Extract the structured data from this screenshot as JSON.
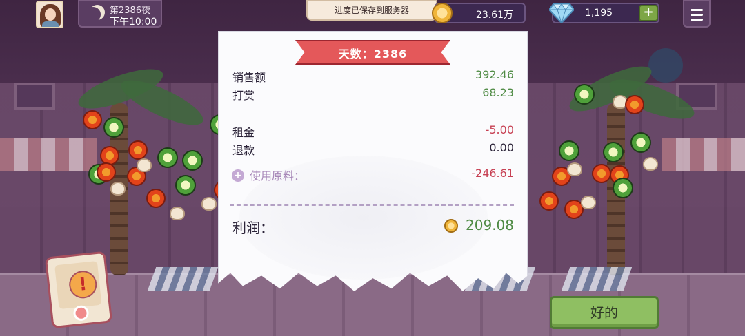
{
  "hud": {
    "day_label": "第2386夜",
    "time_label": "下午10:00",
    "save_toast": "进度已保存到服务器",
    "coins": "23.61万",
    "gems": "1,195",
    "gem_plus": "+"
  },
  "receipt": {
    "title": "天数：2386",
    "rows": [
      {
        "label": "销售额",
        "value": "392.46"
      },
      {
        "label": "打赏",
        "value": "68.23"
      },
      {
        "label": "租金",
        "value": "-5.00"
      },
      {
        "label": "退款",
        "value": "0.00"
      }
    ],
    "materials": {
      "label": "使用原料：",
      "value": "-246.61"
    },
    "profit": {
      "label": "利润：",
      "value": "209.08"
    }
  },
  "actions": {
    "ok_label": "好的",
    "alert_glyph": "!"
  },
  "colors": {
    "positive": "#4f8b44",
    "negative": "#c74053",
    "banner": "#e4585a",
    "ok_button": "#8fbf62"
  }
}
